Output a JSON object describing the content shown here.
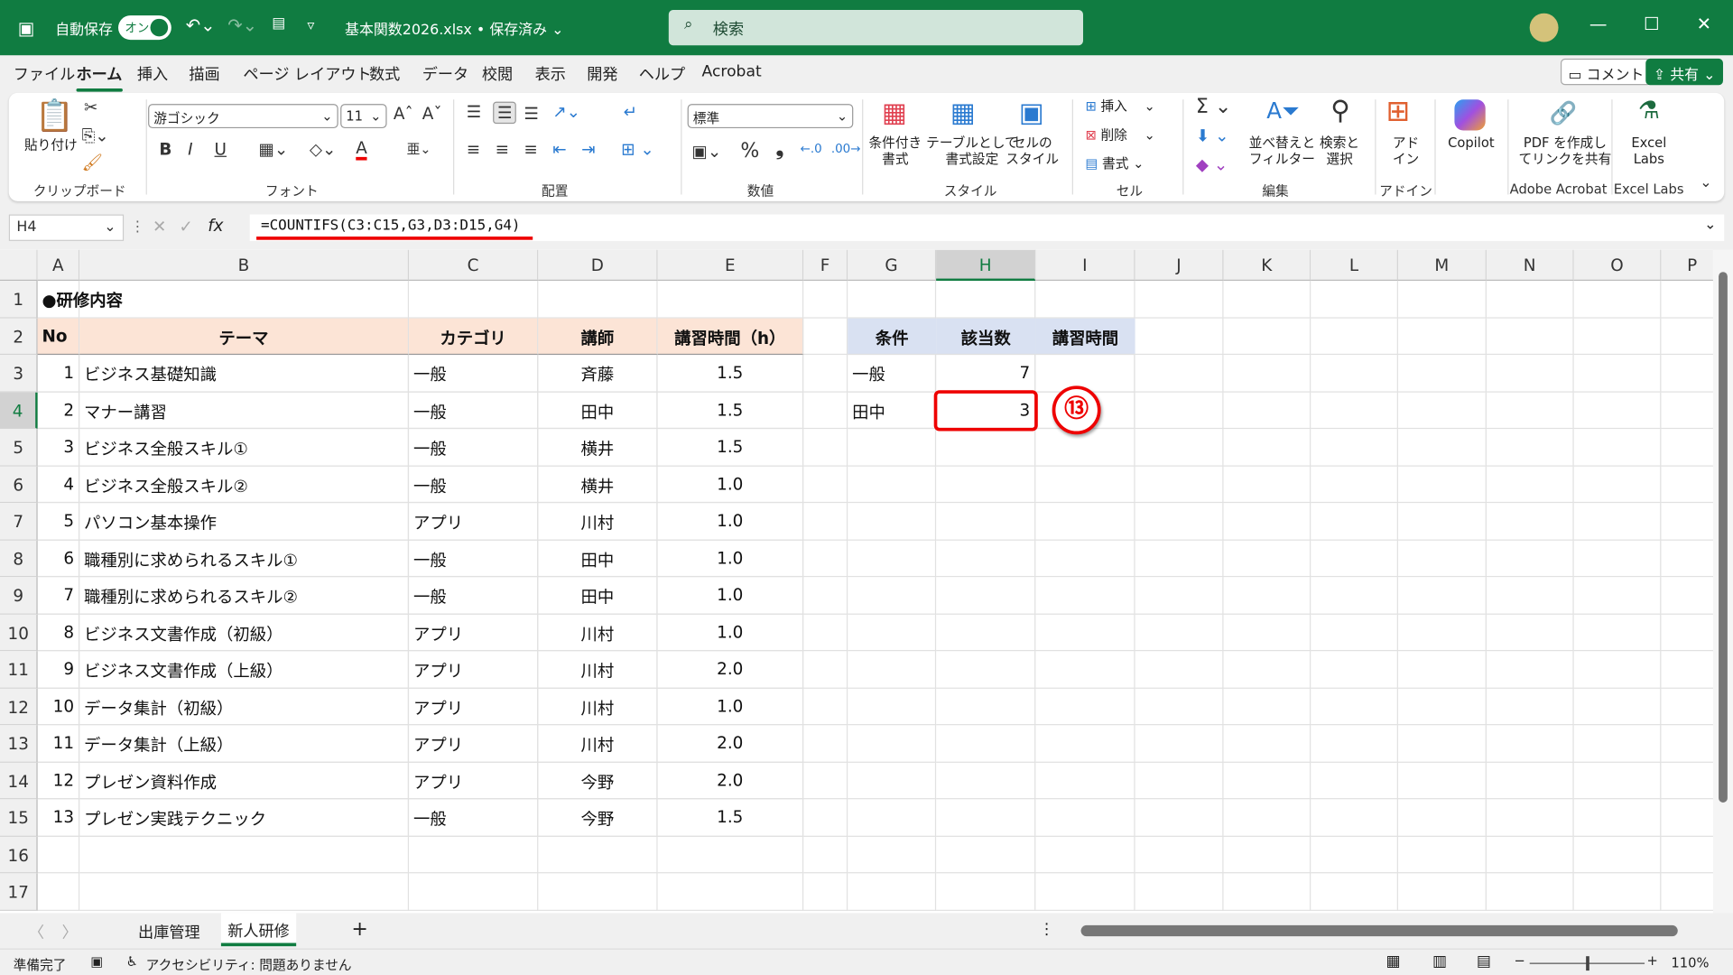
{
  "title": {
    "autosave": "自動保存",
    "toggle": "オン",
    "filename": "基本関数2026.xlsx • 保存済み ⌄",
    "search_placeholder": "検索"
  },
  "tabs": [
    "ファイル",
    "ホーム",
    "挿入",
    "描画",
    "ページ レイアウト",
    "数式",
    "データ",
    "校閲",
    "表示",
    "開発",
    "ヘルプ",
    "Acrobat"
  ],
  "active_tab": "ホーム",
  "top_buttons": {
    "comment": "コメント",
    "share": "共有"
  },
  "ribbon": {
    "clipboard": {
      "paste": "貼り付け",
      "label": "クリップボード"
    },
    "font": {
      "name": "游ゴシック",
      "size": "11",
      "bold": "B",
      "italic": "I",
      "underline": "U",
      "label": "フォント"
    },
    "alignment": {
      "label": "配置"
    },
    "number": {
      "format": "標準",
      "percent": "%",
      "comma": "❟",
      "label": "数値"
    },
    "styles": {
      "conditional": "条件付き\n書式",
      "table": "テーブルとして\n書式設定",
      "cell_styles": "セルの\nスタイル",
      "label": "スタイル"
    },
    "cells": {
      "insert": "挿入",
      "delete": "削除",
      "format": "書式",
      "label": "セル"
    },
    "editing": {
      "sort": "並べ替えと\nフィルター",
      "find": "検索と\n選択",
      "label": "編集"
    },
    "addins": {
      "addin": "アド\nイン",
      "label": "アドイン"
    },
    "copilot": {
      "label": "Copilot"
    },
    "acrobat": {
      "pdf": "PDF を作成し\nてリンクを共有",
      "label": "Adobe Acrobat"
    },
    "excel_labs": {
      "btn": "Excel\nLabs",
      "label": "Excel Labs"
    }
  },
  "formula_bar": {
    "name_box": "H4",
    "fx": "fx",
    "formula": "=COUNTIFS(C3:C15,G3,D3:D15,G4)"
  },
  "columns": [
    "A",
    "B",
    "C",
    "D",
    "E",
    "F",
    "G",
    "H",
    "I",
    "J",
    "K",
    "L",
    "M",
    "N",
    "O",
    "P"
  ],
  "selected_column": "H",
  "selected_row": 4,
  "rows": [
    "1",
    "2",
    "3",
    "4",
    "5",
    "6",
    "7",
    "8",
    "9",
    "10",
    "11",
    "12",
    "13",
    "14",
    "15",
    "16",
    "17"
  ],
  "sheet": {
    "title": "●研修内容",
    "headers": [
      "No",
      "テーマ",
      "カテゴリ",
      "講師",
      "講習時間（h）"
    ],
    "records": [
      [
        "1",
        "ビジネス基礎知識",
        "一般",
        "斉藤",
        "1.5"
      ],
      [
        "2",
        "マナー講習",
        "一般",
        "田中",
        "1.5"
      ],
      [
        "3",
        "ビジネス全般スキル①",
        "一般",
        "横井",
        "1.5"
      ],
      [
        "4",
        "ビジネス全般スキル②",
        "一般",
        "横井",
        "1.0"
      ],
      [
        "5",
        "パソコン基本操作",
        "アプリ",
        "川村",
        "1.0"
      ],
      [
        "6",
        "職種別に求められるスキル①",
        "一般",
        "田中",
        "1.0"
      ],
      [
        "7",
        "職種別に求められるスキル②",
        "一般",
        "田中",
        "1.0"
      ],
      [
        "8",
        "ビジネス文書作成（初級）",
        "アプリ",
        "川村",
        "1.0"
      ],
      [
        "9",
        "ビジネス文書作成（上級）",
        "アプリ",
        "川村",
        "2.0"
      ],
      [
        "10",
        "データ集計（初級）",
        "アプリ",
        "川村",
        "1.0"
      ],
      [
        "11",
        "データ集計（上級）",
        "アプリ",
        "川村",
        "2.0"
      ],
      [
        "12",
        "プレゼン資料作成",
        "アプリ",
        "今野",
        "2.0"
      ],
      [
        "13",
        "プレゼン実践テクニック",
        "一般",
        "今野",
        "1.5"
      ]
    ],
    "summary_headers": [
      "条件",
      "該当数",
      "講習時間"
    ],
    "summary": [
      [
        "一般",
        "7",
        ""
      ],
      [
        "田中",
        "3",
        ""
      ]
    ]
  },
  "annotation": "⑬",
  "sheet_tabs": [
    "出庫管理",
    "新人研修"
  ],
  "active_sheet": "新人研修",
  "status": {
    "ready": "準備完了",
    "accessibility": "アクセシビリティ: 問題ありません",
    "zoom": "110%"
  },
  "colors": {
    "brand": "#107c41",
    "highlight": "#e00000",
    "header_fill": "#fce4d6",
    "summary_fill": "#d9e1f2"
  }
}
